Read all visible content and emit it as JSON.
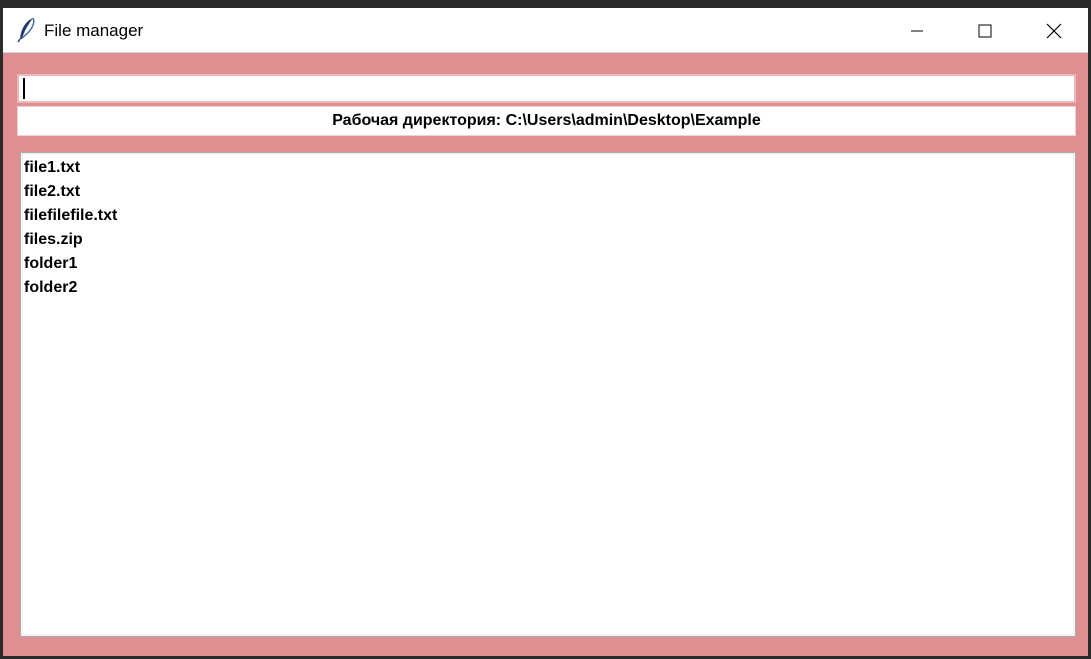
{
  "window": {
    "title": "File manager",
    "icon": "feather-icon",
    "controls": {
      "minimize_icon": "minimize-icon",
      "maximize_icon": "maximize-icon",
      "close_icon": "close-icon"
    }
  },
  "command_input": {
    "value": ""
  },
  "working_directory": {
    "text": "Рабочая директория: C:\\Users\\admin\\Desktop\\Example"
  },
  "files": [
    {
      "name": "file1.txt"
    },
    {
      "name": "file2.txt"
    },
    {
      "name": "filefilefile.txt"
    },
    {
      "name": "files.zip"
    },
    {
      "name": "folder1"
    },
    {
      "name": "folder2"
    }
  ],
  "colors": {
    "window_background": "#df8e91",
    "titlebar": "#ffffff",
    "panel": "#ffffff"
  }
}
